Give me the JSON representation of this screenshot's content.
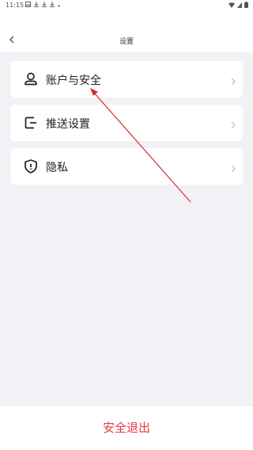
{
  "status_bar": {
    "time": "11:15",
    "notification_icons": [
      "image-icon",
      "download-icon",
      "download-icon",
      "download-icon",
      "dot-icon"
    ],
    "system_icons": [
      "wifi-icon",
      "signal-icon",
      "battery-icon"
    ]
  },
  "header": {
    "title": "设置",
    "back_icon": "chevron-left-icon"
  },
  "settings": {
    "items": [
      {
        "label": "账户与安全",
        "icon": "user-icon"
      },
      {
        "label": "推送设置",
        "icon": "exit-icon"
      },
      {
        "label": "隐私",
        "icon": "shield-icon"
      }
    ]
  },
  "footer": {
    "logout_label": "安全退出"
  },
  "colors": {
    "background": "#f2f2f6",
    "card": "#ffffff",
    "logout": "#e4393c",
    "annotation_arrow": "#d32f2f"
  }
}
